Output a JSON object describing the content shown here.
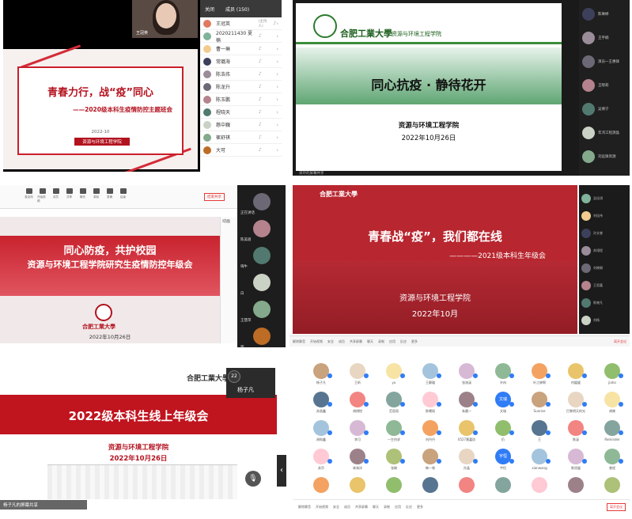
{
  "panel1": {
    "slide_title": "青春力行，战“疫”同心",
    "slide_subtitle": "——2020级本科生疫情防控主题班会",
    "slide_date": "2022-10",
    "slide_tag": "资源与环境工程学院",
    "camera_name": "王冠英",
    "members_header": {
      "close": "关闭",
      "members": "成员 (150)"
    },
    "members": [
      {
        "name": "王冠英",
        "tag": "(主持人)"
      },
      {
        "name": "2020211430 夏楠",
        "tag": ""
      },
      {
        "name": "曹一琳",
        "tag": ""
      },
      {
        "name": "常璐海",
        "tag": ""
      },
      {
        "name": "陈浩伟",
        "tag": ""
      },
      {
        "name": "陈龙升",
        "tag": ""
      },
      {
        "name": "陈玉鹏",
        "tag": ""
      },
      {
        "name": "程晓天",
        "tag": ""
      },
      {
        "name": "慈中巍",
        "tag": ""
      },
      {
        "name": "崔舒祺",
        "tag": ""
      },
      {
        "name": "大可",
        "tag": ""
      }
    ]
  },
  "panel2": {
    "university": "合肥工業大學",
    "school": "资源与环境工程学院",
    "slide_title": "同心抗疫 · 静待花开",
    "slide_org": "资源与环境工程学院",
    "slide_date": "2022年10月26日",
    "share_label": "宋玲的屏幕共享",
    "side": [
      "陈琳婷",
      "王宇楠",
      "演员一王惠锋",
      "王晓莉",
      "吴倩宁",
      "年鸿工程测晶",
      "刘远锋资源"
    ]
  },
  "panel3": {
    "stop_share": "结束共享",
    "toolbar": [
      "麦克风",
      "开始视频",
      "成员",
      "共享",
      "聊天",
      "录制",
      "表情",
      "结束"
    ],
    "slide_title1": "同心防疫，共护校园",
    "slide_title2": "资源与环境工程学院研究生疫情防控年级会",
    "university": "合肥工業大學",
    "slide_date": "2022年10月26日",
    "anim_panel": "动画",
    "side": [
      "正在讲话",
      "陈美眉",
      "嗨牛",
      "白",
      "王慧萍",
      "郭"
    ]
  },
  "panel4": {
    "university": "合肥工業大學",
    "slide_title": "青春战“疫”，我们都在线",
    "slide_subtitle": "————2021级本科生年级会",
    "slide_org": "资源与环境工程学院",
    "slide_date": "2022年10月",
    "bottom": [
      "解除静音",
      "开始视频",
      "安全",
      "成员",
      "共享屏幕",
      "聊天",
      "录制",
      "应用",
      "反应",
      "更多"
    ],
    "leave": "离开会议",
    "side": [
      "吴佳琪",
      "刘佳伟",
      "孙文睿",
      "苏翊程",
      "刘晓娴",
      "王思嘉",
      "陈晓凡",
      "刘杨"
    ]
  },
  "panel5": {
    "university": "合肥工業大學",
    "slide_title": "2022级本科生线上年级会",
    "slide_org": "资源与环境工程学院",
    "slide_date": "2022年10月26日",
    "share_label": "杨子凡的屏幕共享",
    "video_name": "杨子凡",
    "video_badge": "22",
    "mic_icon": "microphone-icon",
    "arrow": "‹"
  },
  "panel6": {
    "rows": [
      [
        "杨子凡",
        "王昕",
        "yu",
        "王静璇",
        "张洛溪",
        "许冉",
        "叶江婷啊",
        "何媛媛",
        "jiaho"
      ],
      [
        "苏昌鑫",
        "胡祺悦",
        "范思雨",
        "陈曦瑶",
        "朱晨一",
        "文瑞",
        "Sunrise",
        "巴黎明天的光",
        "胡晓"
      ],
      [
        "胡昀鑫",
        "李可",
        "一生何求",
        "刘丹丹",
        "0527黄嘉欣",
        "仍",
        "王",
        "陈溪",
        "Reminder"
      ],
      [
        "苏莎",
        "林海洋",
        "张琳",
        "韩一顿",
        "孙晶",
        "宇恒",
        "xianwang",
        "陈欣媛",
        "曾程"
      ],
      [
        "",
        "",
        "",
        "",
        "",
        "",
        "",
        "",
        ""
      ]
    ],
    "text_avatars": {
      "文瑞": "文瑞",
      "宇恒": "宇恒"
    },
    "bottom": [
      "解除静音",
      "开始视频",
      "安全",
      "成员",
      "共享屏幕",
      "聊天",
      "录制",
      "应用",
      "反应",
      "更多"
    ],
    "leave": "离开会议"
  }
}
